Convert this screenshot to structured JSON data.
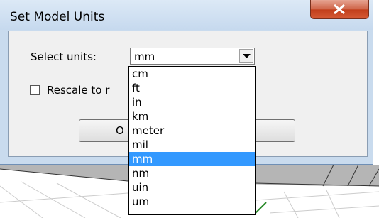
{
  "dialog": {
    "title": "Set Model Units",
    "select_units_label": "Select units:",
    "selected_value": "mm",
    "rescale_label": "Rescale to r",
    "ok_label": "O",
    "cancel_label": "ancel",
    "close_icon": "close-x-icon",
    "close_button_color": "#c94a2b",
    "selection_color": "#3399ff"
  },
  "dropdown": {
    "options": [
      {
        "label": "cm"
      },
      {
        "label": "ft"
      },
      {
        "label": "in"
      },
      {
        "label": "km"
      },
      {
        "label": "meter"
      },
      {
        "label": "mil"
      },
      {
        "label": "mm",
        "selected": true
      },
      {
        "label": "nm"
      },
      {
        "label": "uin"
      },
      {
        "label": "um"
      }
    ]
  }
}
